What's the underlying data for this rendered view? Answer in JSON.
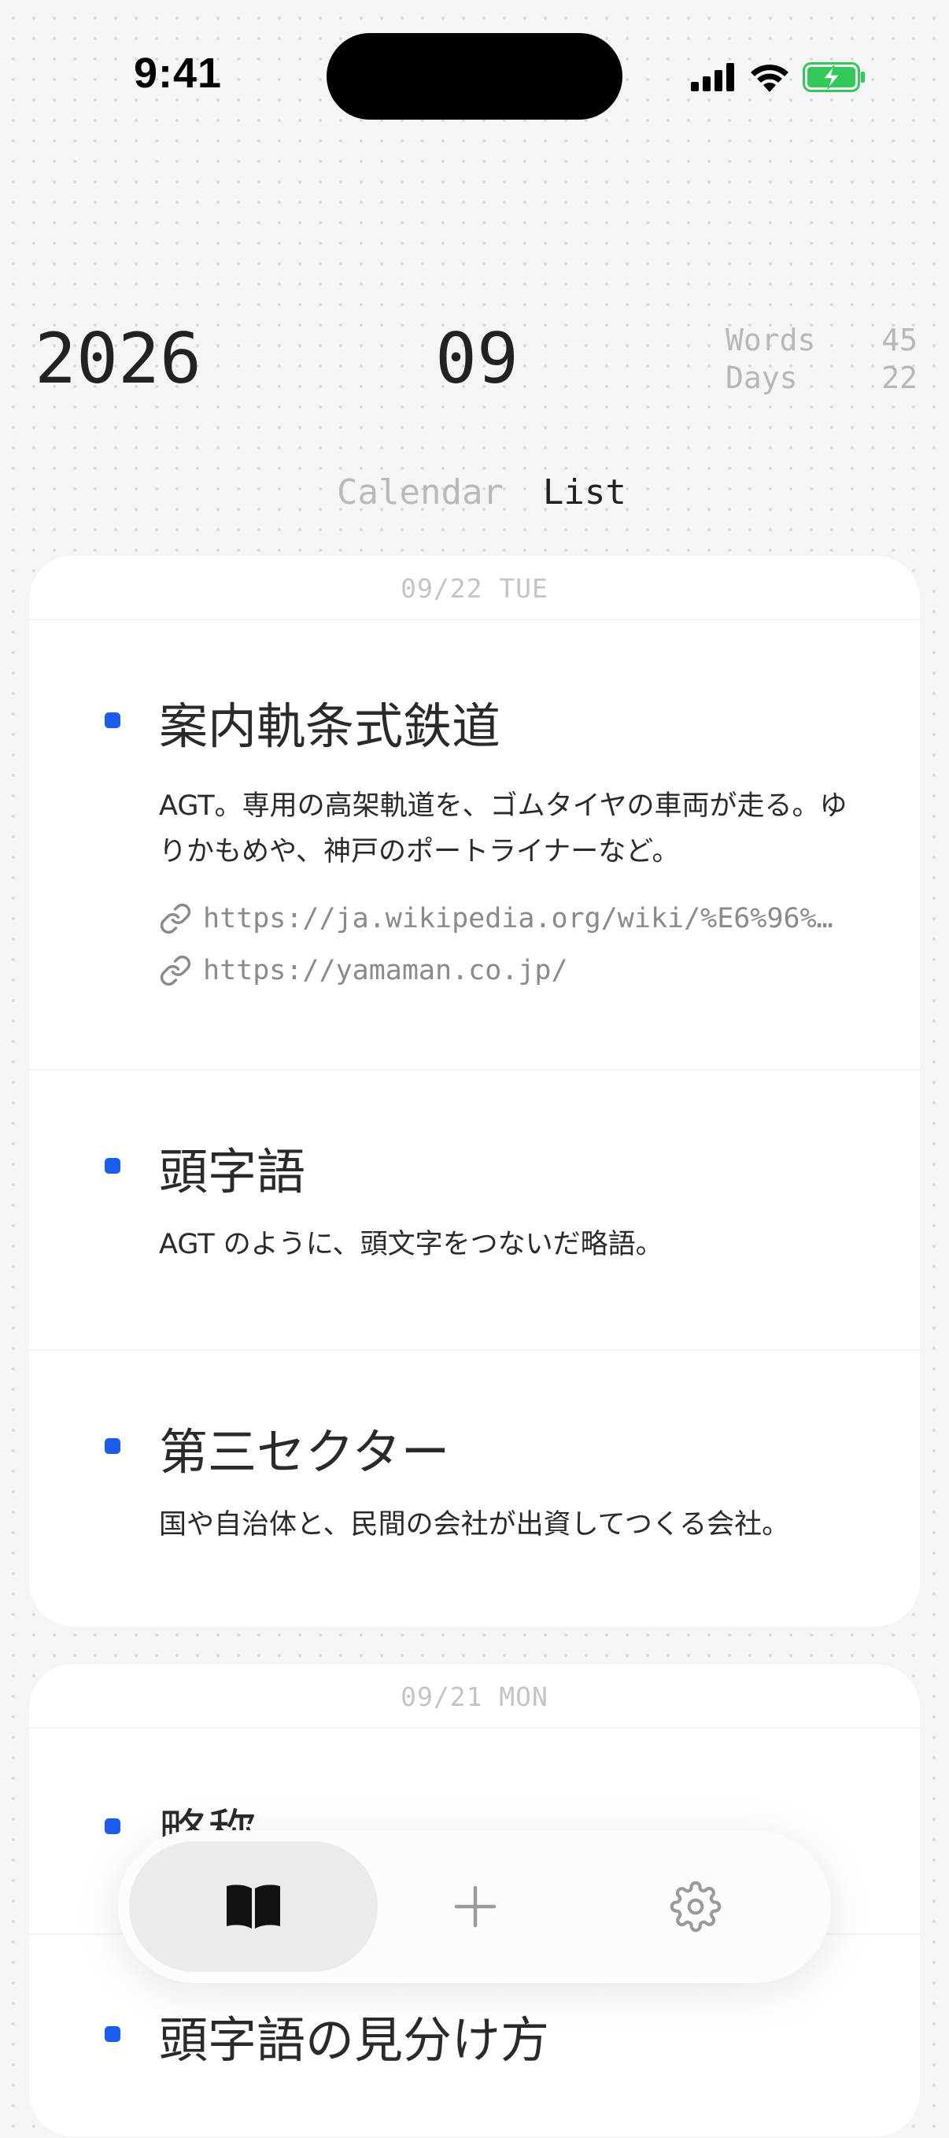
{
  "status_bar": {
    "time": "9:41"
  },
  "header": {
    "year": "2026",
    "month": "09",
    "stats": [
      {
        "label": "Words",
        "value": "45"
      },
      {
        "label": "Days",
        "value": "22"
      }
    ]
  },
  "view_toggle": {
    "calendar": "Calendar",
    "list": "List",
    "selected": "List"
  },
  "days": [
    {
      "date": "09/22 TUE",
      "entries": [
        {
          "title": "案内軌条式鉄道",
          "description": "AGT。専用の高架軌道を、ゴムタイヤの車両が走る。ゆりかもめや、神戸のポートライナーなど。",
          "links": [
            "https://ja.wikipedia.org/wiki/%E6%96%…",
            "https://yamaman.co.jp/"
          ]
        },
        {
          "title": "頭字語",
          "description": "AGT のように、頭文字をつないだ略語。"
        },
        {
          "title": "第三セクター",
          "description": "国や自治体と、民間の会社が出資してつくる会社。"
        }
      ]
    },
    {
      "date": "09/21 MON",
      "entries": [
        {
          "title": "略称"
        },
        {
          "title": "頭字語の見分け方"
        }
      ]
    }
  ],
  "tab_bar": {
    "items": [
      {
        "icon": "book-open-icon",
        "selected": true
      },
      {
        "icon": "plus-icon",
        "selected": false
      },
      {
        "icon": "gear-icon",
        "selected": false
      }
    ]
  },
  "colors": {
    "accent": "#1a5cf0",
    "background": "#f5f5f5",
    "battery": "#34c759"
  }
}
